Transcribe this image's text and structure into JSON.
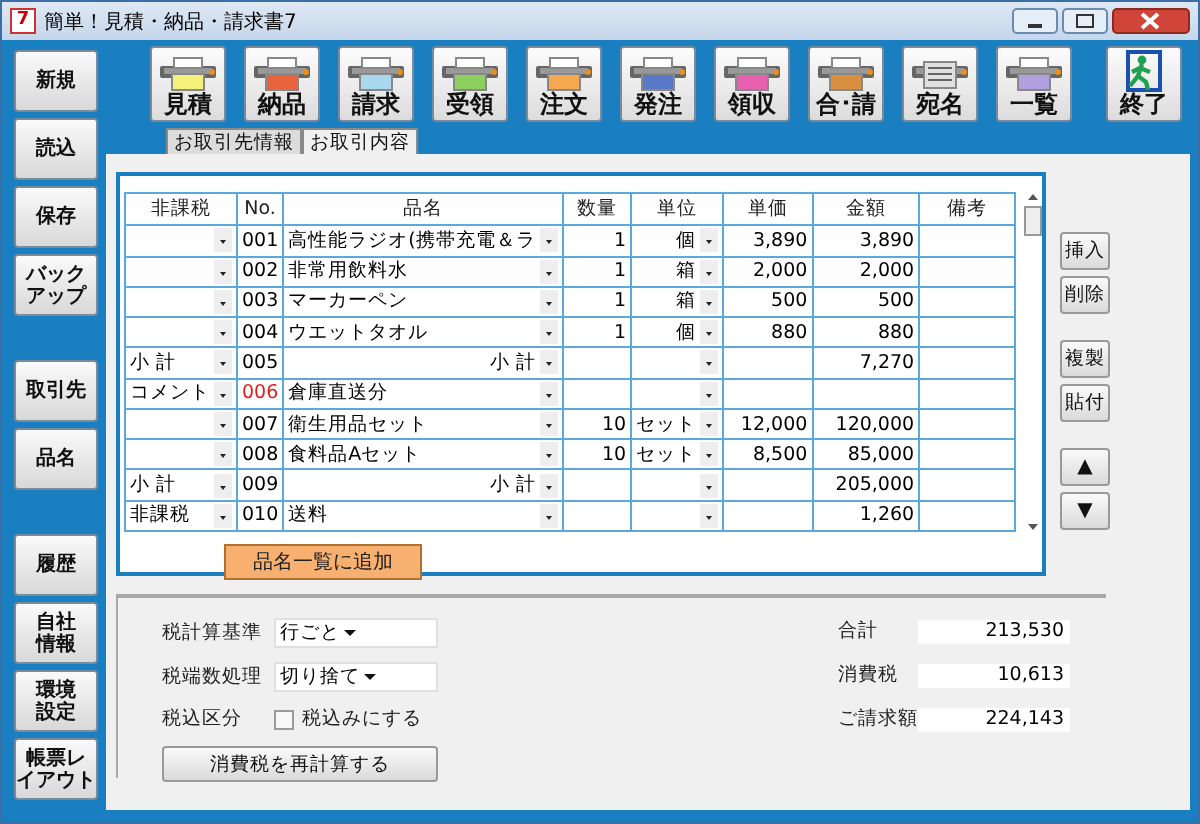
{
  "window": {
    "app_icon": "7",
    "title": "簡単！見積・納品・請求書7"
  },
  "left_button_groups": [
    [
      {
        "lines": [
          "新規"
        ]
      },
      {
        "lines": [
          "読込"
        ]
      },
      {
        "lines": [
          "保存"
        ]
      },
      {
        "lines": [
          "バック",
          "アップ"
        ]
      }
    ],
    [
      {
        "lines": [
          "取引先"
        ]
      },
      {
        "lines": [
          "品名"
        ]
      }
    ],
    [
      {
        "lines": [
          "履歴"
        ]
      },
      {
        "lines": [
          "自社",
          "情報"
        ]
      },
      {
        "lines": [
          "環境",
          "設定"
        ]
      },
      {
        "lines": [
          "帳票レ",
          "イアウト"
        ]
      }
    ]
  ],
  "toolbar": [
    {
      "label": "見積",
      "kind": "printer",
      "color": "#f4f07a"
    },
    {
      "label": "納品",
      "kind": "printer",
      "color": "#e8643c"
    },
    {
      "label": "請求",
      "kind": "printer",
      "color": "#a8d8f0"
    },
    {
      "label": "受領",
      "kind": "printer",
      "color": "#8cd060"
    },
    {
      "label": "注文",
      "kind": "printer",
      "color": "#f4a850"
    },
    {
      "label": "発注",
      "kind": "printer",
      "color": "#5878c8"
    },
    {
      "label": "領収",
      "kind": "printer",
      "color": "#e860b0"
    },
    {
      "label": "合･請",
      "kind": "printer",
      "color": "#d89040"
    },
    {
      "label": "宛名",
      "kind": "list",
      "color": "#e0e0e0"
    },
    {
      "label": "一覧",
      "kind": "printer",
      "color": "#b0a0e0"
    },
    {
      "label": "終了",
      "kind": "exit"
    }
  ],
  "tabs": [
    {
      "label": "お取引先情報",
      "selected": false
    },
    {
      "label": "お取引内容",
      "selected": true
    }
  ],
  "table": {
    "columns": [
      "非課税",
      "No.",
      "品名",
      "数量",
      "単位",
      "単価",
      "金額",
      "備考"
    ],
    "rows": [
      {
        "kind": "item",
        "tax": "",
        "no": "001",
        "name": "高性能ラジオ(携帯充電＆ラ",
        "qty": "1",
        "unit": "個",
        "price": "3,890",
        "amount": "3,890"
      },
      {
        "kind": "item",
        "tax": "",
        "no": "002",
        "name": "非常用飲料水",
        "qty": "1",
        "unit": "箱",
        "price": "2,000",
        "amount": "2,000"
      },
      {
        "kind": "item",
        "tax": "",
        "no": "003",
        "name": "マーカーペン",
        "qty": "1",
        "unit": "箱",
        "price": "500",
        "amount": "500"
      },
      {
        "kind": "item",
        "tax": "",
        "no": "004",
        "name": "ウエットタオル",
        "qty": "1",
        "unit": "個",
        "price": "880",
        "amount": "880"
      },
      {
        "kind": "subtotal",
        "tax": "小 計",
        "no": "005",
        "name": "小 計",
        "qty": "",
        "unit": "",
        "price": "",
        "amount": "7,270"
      },
      {
        "kind": "comment",
        "tax": "コメント",
        "no": "006",
        "name": "倉庫直送分",
        "qty": "",
        "unit": "",
        "price": "",
        "amount": ""
      },
      {
        "kind": "item",
        "tax": "",
        "no": "007",
        "name": "衛生用品セット",
        "qty": "10",
        "unit": "セット",
        "price": "12,000",
        "amount": "120,000"
      },
      {
        "kind": "item",
        "tax": "",
        "no": "008",
        "name": "食料品Aセット",
        "qty": "10",
        "unit": "セット",
        "price": "8,500",
        "amount": "85,000"
      },
      {
        "kind": "subtotal",
        "tax": "小 計",
        "no": "009",
        "name": "小 計",
        "qty": "",
        "unit": "",
        "price": "",
        "amount": "205,000"
      },
      {
        "kind": "item",
        "tax": "非課税",
        "no": "010",
        "name": "送料",
        "qty": "",
        "unit": "",
        "price": "",
        "amount": "1,260"
      }
    ]
  },
  "add_button": "品名一覧に追加",
  "side_buttons": [
    {
      "label": "挿入",
      "kind": "text"
    },
    {
      "label": "削除",
      "kind": "text"
    },
    {
      "label": "複製",
      "kind": "text"
    },
    {
      "label": "貼付",
      "kind": "text"
    },
    {
      "label": "▲",
      "kind": "arrow"
    },
    {
      "label": "▼",
      "kind": "arrow"
    }
  ],
  "tax_settings": {
    "basis": {
      "label": "税計算基準",
      "value": "行ごと"
    },
    "rounding": {
      "label": "税端数処理",
      "value": "切り捨て"
    },
    "inclusive": {
      "label": "税込区分",
      "option": "税込みにする",
      "checked": false
    },
    "recalc_button": "消費税を再計算する"
  },
  "totals": [
    {
      "label": "合計",
      "value": "213,530"
    },
    {
      "label": "消費税",
      "value": "10,613"
    },
    {
      "label": "ご請求額",
      "value": "224,143"
    }
  ]
}
